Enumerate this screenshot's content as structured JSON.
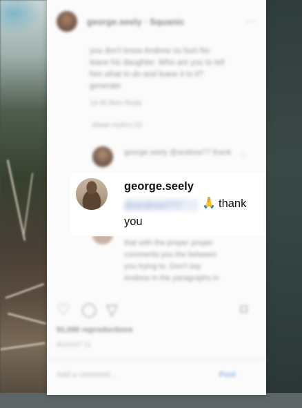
{
  "post": {
    "header_username": "george.seely · Squanic",
    "more_glyph": "···",
    "caption": "you don't know Andrew so hurt his leave his daughter. Who are you to tell him what to do and leave it to it? generate",
    "caption_meta": "1d   45 likes   Reply",
    "hidden_replies": "Show replies (3)",
    "reply1_text": "george.seely @andrew77 thank",
    "reply2_text": "that with the proper proper comments you the between you trying to. Don't say Andrew in the paragraphs in",
    "heart_glyph": "♡",
    "views": "91,090 reproductions",
    "date": "AUGUST 21",
    "add_comment_placeholder": "Add a comment...",
    "post_label": "Post"
  },
  "highlight": {
    "username": "george.seely",
    "mention": "@andrew777",
    "pray_emoji": "🙏",
    "word1": "thank",
    "word2": "you"
  },
  "icons": {
    "like": "♡",
    "comment": "◯",
    "share": "▽",
    "save": "⌑"
  }
}
